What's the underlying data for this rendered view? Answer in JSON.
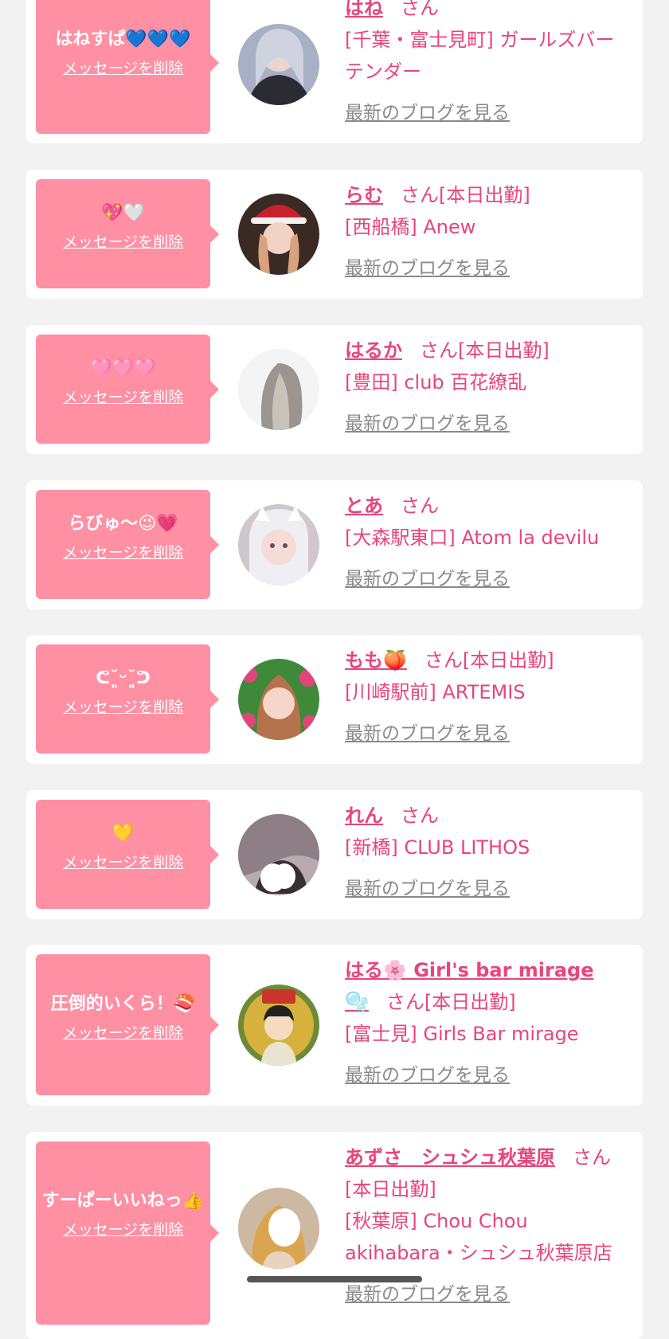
{
  "delete_label": "メッセージを削除",
  "blog_label": "最新のブログを見る",
  "san_suffix": "さん",
  "cards": [
    {
      "message": "はねすぱ💙💙💙",
      "name": "はね",
      "status": "",
      "shop": "[千葉・富士見町] ガールズバー テンダー",
      "avatar_icon": "avatar-photo"
    },
    {
      "message": "💖🤍",
      "name": "らむ",
      "status": "[本日出勤]",
      "shop": "[西船橋] Anew",
      "avatar_icon": "avatar-photo"
    },
    {
      "message": "🩷🩷🩷",
      "name": "はるか",
      "status": "[本日出勤]",
      "shop": "[豊田] club 百花繚乱",
      "avatar_icon": "avatar-photo"
    },
    {
      "message": "らびゅ〜😉💗",
      "name": "とあ",
      "status": "",
      "shop": "[大森駅東口] Atom la devilu",
      "avatar_icon": "avatar-photo"
    },
    {
      "message": "ᕦ˘͈ᵕ˘͈ᕤ",
      "name": "もも🍑",
      "status": "[本日出勤]",
      "shop": "[川崎駅前] ARTEMIS",
      "avatar_icon": "avatar-photo"
    },
    {
      "message": "💛",
      "name": "れん",
      "status": "",
      "shop": "[新橋] CLUB LITHOS",
      "avatar_icon": "avatar-photo"
    },
    {
      "message": "圧倒的いくら！🍣",
      "name": "はる🌸 Girl's bar mirage🫧",
      "status": "[本日出勤]",
      "shop": "[富士見] Girls Bar mirage",
      "avatar_icon": "avatar-illustration"
    },
    {
      "message": "すーぱーいいねっ👍",
      "name": "あずさ　シュシュ秋葉原",
      "status": "[本日出勤]",
      "shop": "[秋葉原] Chou Chou akihabara・シュシュ秋葉原店",
      "avatar_icon": "avatar-photo"
    }
  ]
}
